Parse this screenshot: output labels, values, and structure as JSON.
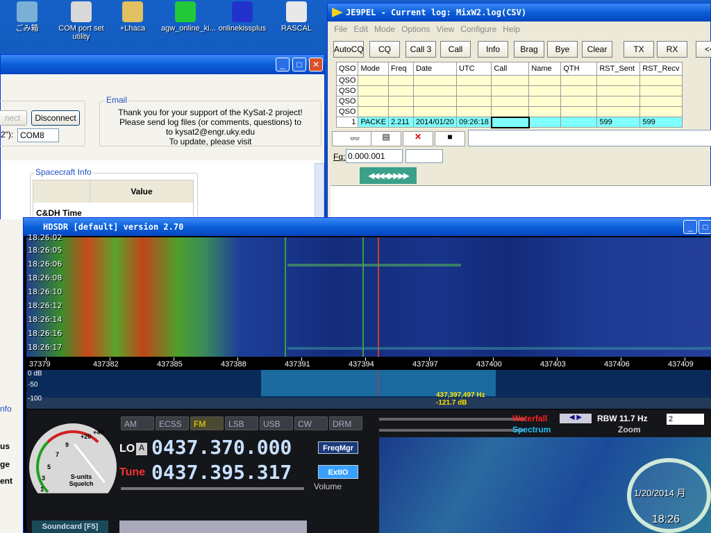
{
  "desktop": {
    "icons": [
      {
        "label": "ごみ箱",
        "color": "#7ab0d8"
      },
      {
        "label": "COM port set utility",
        "color": "#d9d9d9"
      },
      {
        "label": "+Lhaca",
        "color": "#e0c060"
      },
      {
        "label": "agw_online_ki...",
        "color": "#22c83a"
      },
      {
        "label": "onlinekissplus",
        "color": "#2233cc"
      },
      {
        "label": "RASCAL",
        "color": "#e8e8e8"
      }
    ]
  },
  "kysat": {
    "connect_label": "nect",
    "disconnect_label": "Disconnect",
    "port_label": "2\"):",
    "port_value": "COM8",
    "email_group": "Email",
    "email_text": [
      "Thank you for your support of the KySat-2 project!",
      "Please send log files (or comments, questions) to",
      "to kysat2@engr.uky.edu",
      "To update, please visit"
    ],
    "info_group": "Spacecraft Info",
    "col_value": "Value",
    "row_label": "C&DH Time",
    "side_labels": [
      "nfo",
      "us",
      "ge",
      "ent"
    ]
  },
  "logger": {
    "title": "JE9PEL - Current log: MixW2.log(CSV)",
    "menu": [
      "File",
      "Edit",
      "Mode",
      "Options",
      "View",
      "Configure",
      "Help"
    ],
    "toolbar": [
      "AutoCQ",
      "CQ",
      "Call 3",
      "Call",
      "Info",
      "Brag",
      "Bye",
      "Clear",
      "TX",
      "RX",
      "<<"
    ],
    "columns": [
      "QSO",
      "Mode",
      "Freq",
      "Date",
      "UTC",
      "Call",
      "Name",
      "QTH",
      "RST_Sent",
      "RST_Recv"
    ],
    "empty_rows": [
      "QSO",
      "QSO",
      "QSO",
      "QSO"
    ],
    "entry": [
      "1",
      "PACKE",
      "2.211",
      "2014/01/20",
      "09:26:18",
      "",
      "",
      "",
      "599",
      "599"
    ],
    "fq_label": "Fq:",
    "fq_value": "0.000.001"
  },
  "hdsdr": {
    "title": "HDSDR [default]  version 2.70",
    "times": [
      "18:26:02",
      "18:26:05",
      "18:26:06",
      "18:26:08",
      "18:26:10",
      "18:26:12",
      "18:26:14",
      "18:26:16",
      "18:26:17"
    ],
    "freq_ticks": [
      "37379",
      "437382",
      "437385",
      "437388",
      "437391",
      "437394",
      "437397",
      "437400",
      "437403",
      "437406",
      "437409"
    ],
    "db_ticks": [
      "0 dB",
      "-50",
      "-100"
    ],
    "cursor_freq": "437,397,497 Hz",
    "cursor_db": "-121.7 dB",
    "modes": [
      "AM",
      "ECSS",
      "FM",
      "LSB",
      "USB",
      "CW",
      "DRM"
    ],
    "active_mode": "FM",
    "lo_label": "LO",
    "lo_a": "A",
    "lo_value": "0437.370.000",
    "tune_label": "Tune",
    "tune_value": "0437.395.317",
    "freqmgr": "FreqMgr",
    "extio": "ExtIO",
    "volume": "Volume",
    "smeter_labels": [
      "+40",
      "+20",
      "9",
      "7",
      "5",
      "3",
      "1"
    ],
    "smeter_caption": "S-units Squelch",
    "soundcard": "Soundcard  [F5]",
    "waterfall": "Waterfall",
    "spectrum": "Spectrum",
    "rbw": "RBW 11.7 Hz",
    "zoom": "Zoom",
    "rbw_sel": "2",
    "clock_date": "1/20/2014 月",
    "clock_time": "18:26"
  }
}
